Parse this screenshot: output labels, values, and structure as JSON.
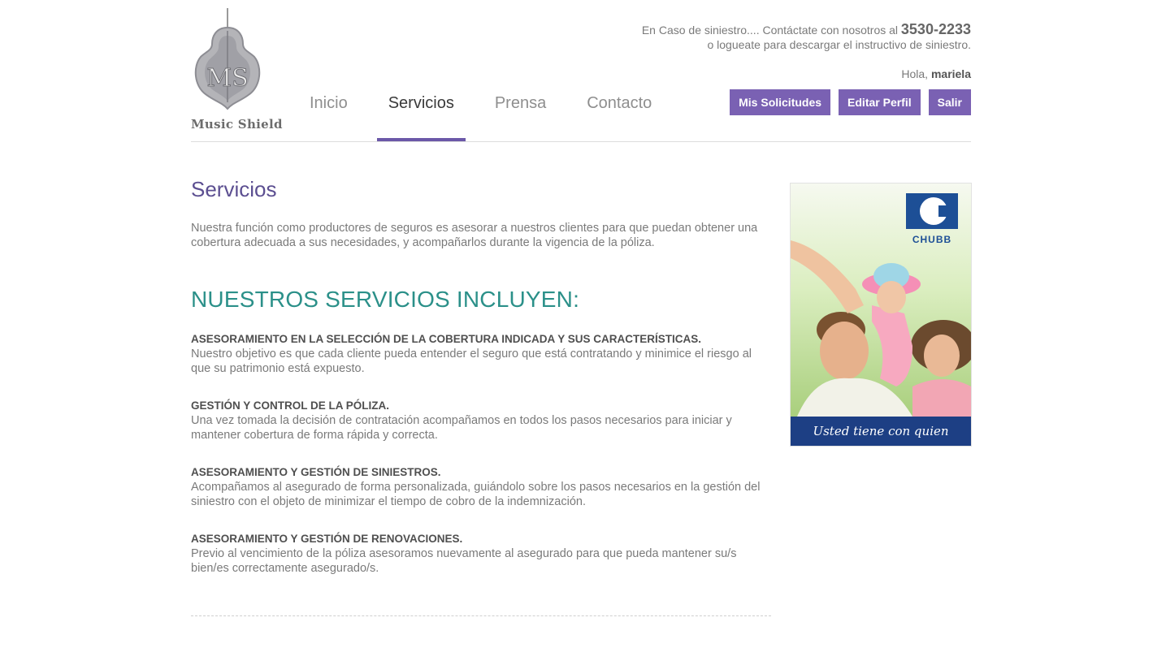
{
  "brand": {
    "logo_monogram": "MS",
    "logo_wordmark": "Music Shield"
  },
  "header": {
    "emergency_prefix": "En Caso de siniestro.... Contáctate con nosotros al",
    "phone": "3530-2233",
    "emergency_line2": "o logueate para descargar el instructivo de siniestro.",
    "greeting_prefix": "Hola,",
    "user_name": "mariela",
    "buttons": [
      "Mis Solicitudes",
      "Editar Perfil",
      "Salir"
    ]
  },
  "nav": {
    "items": [
      "Inicio",
      "Servicios",
      "Prensa",
      "Contacto"
    ],
    "active": "Servicios"
  },
  "main": {
    "title": "Servicios",
    "intro": "Nuestra función como productores de seguros es asesorar a nuestros clientes para que puedan obtener una cobertura adecuada a sus necesidades, y acompañarlos durante la vigencia de la póliza.",
    "subtitle": "NUESTROS SERVICIOS INCLUYEN:",
    "services": [
      {
        "heading": "ASESORAMIENTO EN LA SELECCIÓN DE LA COBERTURA INDICADA Y SUS CARACTERÍSTICAS.",
        "text": "Nuestro objetivo es que cada cliente pueda entender el seguro que está contratando y minimice el riesgo al que su patrimonio está expuesto."
      },
      {
        "heading": "GESTIÓN Y CONTROL DE LA PÓLIZA.",
        "text": "Una vez tomada la decisión de contratación acompañamos en todos los pasos necesarios para iniciar y mantener cobertura de forma rápida y correcta."
      },
      {
        "heading": "ASESORAMIENTO Y GESTIÓN DE SINIESTROS.",
        "text": "Acompañamos al asegurado de forma personalizada, guiándolo sobre los pasos necesarios en la gestión del siniestro con el objeto de minimizar el tiempo de cobro de la indemnización."
      },
      {
        "heading": "ASESORAMIENTO Y GESTIÓN DE RENOVACIONES.",
        "text": "Previo al vencimiento de la póliza asesoramos nuevamente al asegurado para que pueda mantener su/s bien/es correctamente asegurado/s."
      }
    ]
  },
  "ad": {
    "brand": "CHUBB",
    "caption": "Usted tiene con quien contar."
  },
  "colors": {
    "accent_purple": "#7a61b3",
    "title_purple": "#5c4f91",
    "teal": "#2b9089",
    "chubb_blue": "#1d3f84"
  }
}
